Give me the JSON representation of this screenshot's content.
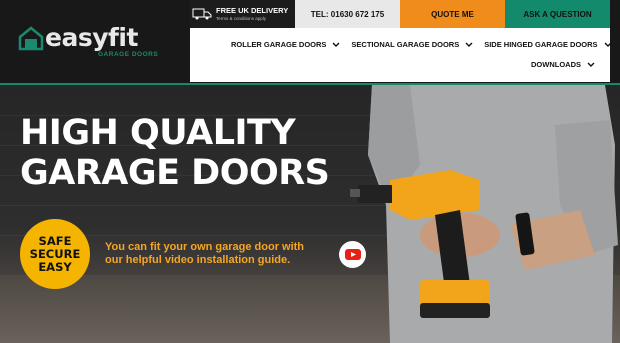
{
  "brand": {
    "name": "easyfit",
    "sub": "GARAGE DOORS"
  },
  "top_bar": {
    "delivery_main": "FREE UK DELIVERY",
    "delivery_sub": "Terms & conditions apply",
    "tel": "TEL: 01630 672 175",
    "quote": "QUOTE ME",
    "ask": "ASK A QUESTION"
  },
  "nav": {
    "items": [
      {
        "label": "ROLLER GARAGE DOORS"
      },
      {
        "label": "SECTIONAL GARAGE DOORS"
      },
      {
        "label": "SIDE HINGED GARAGE DOORS"
      },
      {
        "label": "DOWNLOADS"
      }
    ]
  },
  "hero": {
    "headline_line1": "HIGH QUALITY",
    "headline_line2": "GARAGE DOORS",
    "badge": [
      "SAFE",
      "SECURE",
      "EASY"
    ],
    "tagline_line1": "You can fit your own garage door with",
    "tagline_line2": "our helpful video installation guide."
  },
  "colors": {
    "teal": "#138a6c",
    "orange": "#f08c1c",
    "yellow": "#f5b400"
  },
  "icons": [
    "house-logo-icon",
    "delivery-truck-icon",
    "chevron-down-icon",
    "youtube-play-icon"
  ]
}
